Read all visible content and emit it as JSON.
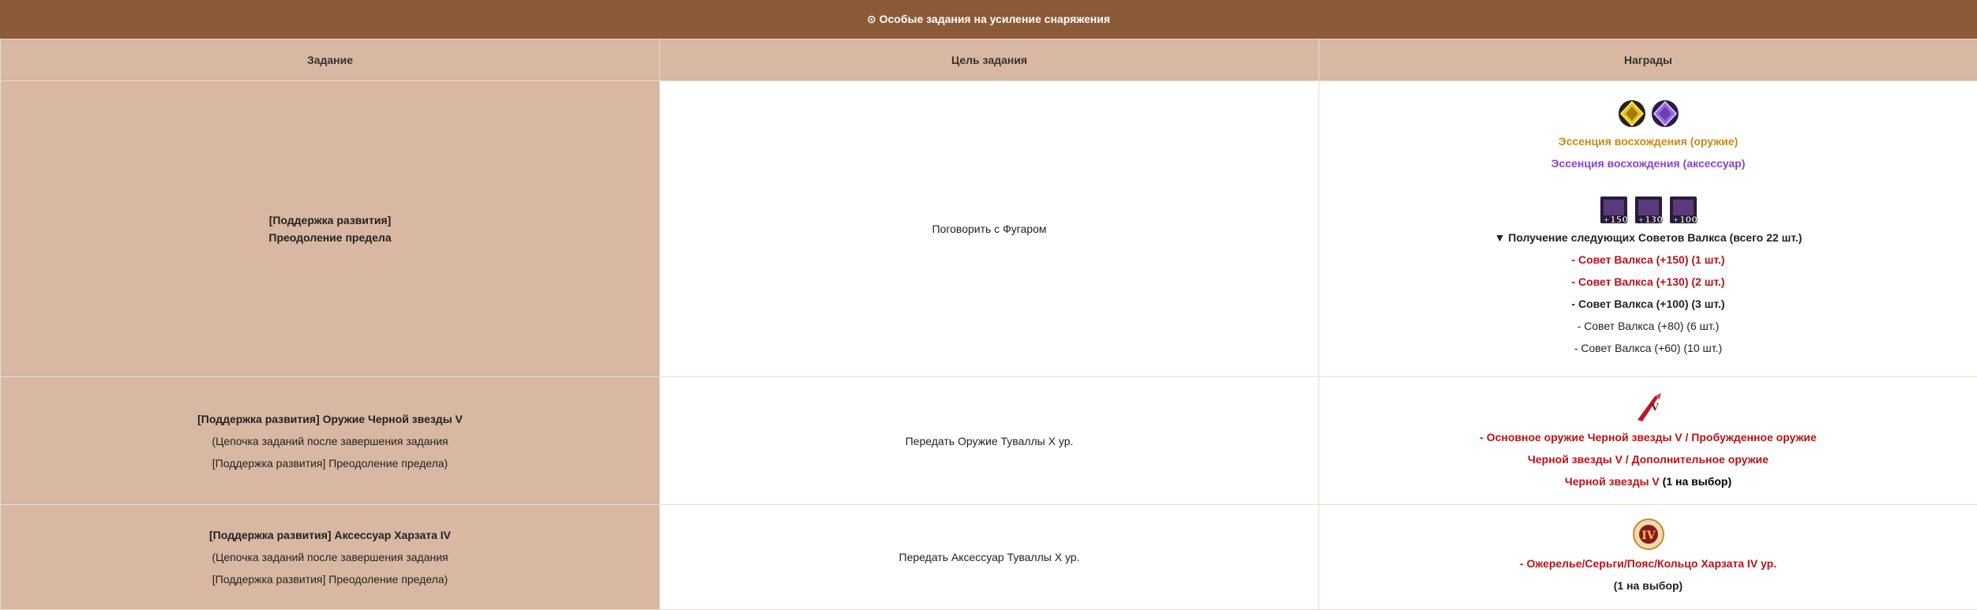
{
  "title": "⊙ Особые задания на усиление снаряжения",
  "headers": {
    "task": "Задание",
    "goal": "Цель задания",
    "rewards": "Награды"
  },
  "rows": [
    {
      "task_lines": [
        "[Поддержка развития]",
        "Преодоление предела"
      ],
      "goal": "Поговорить с Фугаром",
      "essence_weapon": "Эссенция восхождения (оружие)",
      "essence_accessory": "Эссенция восхождения (аксессуар)",
      "scroll_badges": [
        "+150",
        "+130",
        "+100"
      ],
      "advice_header": "▼ Получение следующих Советов Валкса (всего 22 шт.)",
      "advice": [
        "- Совет Валкса (+150) (1 шт.)",
        "- Совет Валкса (+130) (2 шт.)",
        "- Совет Валкса (+100) (3 шт.)",
        "- Совет Валкса (+80) (6 шт.)",
        "- Совет Валкса (+60) (10 шт.)"
      ]
    },
    {
      "task_lines": [
        "[Поддержка развития] Оружие Черной звезды V",
        "(Цепочка заданий после завершения задания",
        "[Поддержка развития] Преодоление предела)"
      ],
      "goal": "Передать Оружие Туваллы X ур.",
      "reward_lines": [
        "- Основное оружие Черной звезды V / Пробужденное оружие",
        "Черной звезды V / Дополнительное оружие",
        "Черной звезды V"
      ],
      "reward_suffix": " (1 на выбор)"
    },
    {
      "task_lines": [
        "[Поддержка развития] Аксессуар Харзата IV",
        "(Цепочка заданий после завершения задания",
        "[Поддержка развития] Преодоление предела)"
      ],
      "goal": "Передать Аксессуар Туваллы X ур.",
      "reward_lines": [
        "- Ожерелье/Серьги/Пояс/Кольцо Харзата IV ур.",
        "(1 на выбор)"
      ]
    }
  ]
}
